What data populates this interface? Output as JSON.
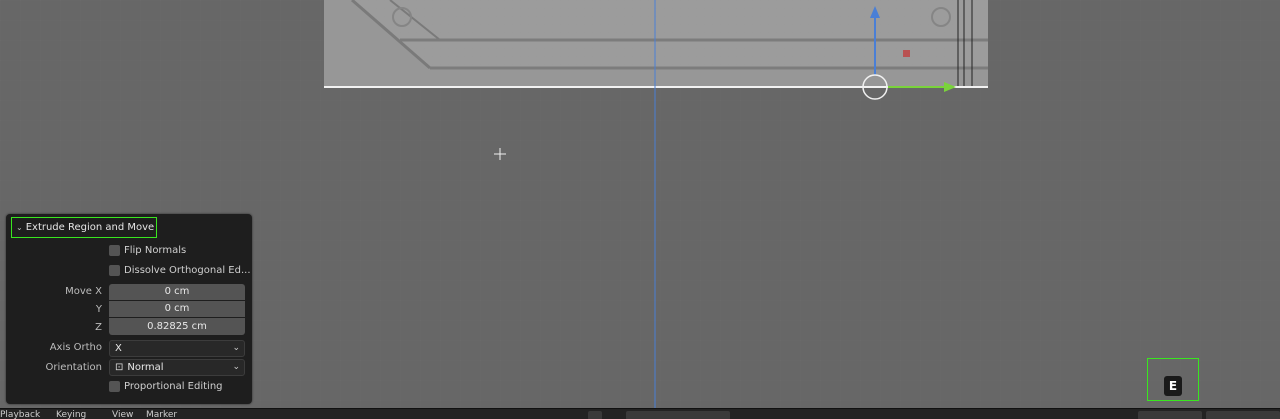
{
  "operator_panel": {
    "title": "Extrude Region and Move",
    "flip_normals": {
      "label": "Flip Normals",
      "checked": false
    },
    "dissolve_orthogonal": {
      "label": "Dissolve Orthogonal Ed...",
      "checked": false
    },
    "move": {
      "x": {
        "label": "Move X",
        "value": "0 cm"
      },
      "y": {
        "label": "Y",
        "value": "0 cm"
      },
      "z": {
        "label": "Z",
        "value": "0.82825 cm"
      }
    },
    "axis_ortho": {
      "label": "Axis Ortho",
      "value": "X"
    },
    "orientation": {
      "label": "Orientation",
      "value": "Normal"
    },
    "proportional_editing": {
      "label": "Proportional Editing",
      "checked": false
    }
  },
  "key_overlay": {
    "key": "E"
  },
  "bottom_bar": {
    "items": [
      "Playback",
      "Keying",
      "View",
      "Marker"
    ]
  },
  "colors": {
    "highlight_green": "#39e61f",
    "axis_blue": "#4a7fd6",
    "gizmo_green": "#7ad33b",
    "gizmo_red": "#c04040"
  },
  "icons": [
    "cursor-icon",
    "gizmo-arrow-z-icon",
    "gizmo-arrow-y-icon",
    "gizmo-center-circle-icon",
    "checkbox-icon",
    "chevron-down-icon",
    "orientation-icon"
  ]
}
